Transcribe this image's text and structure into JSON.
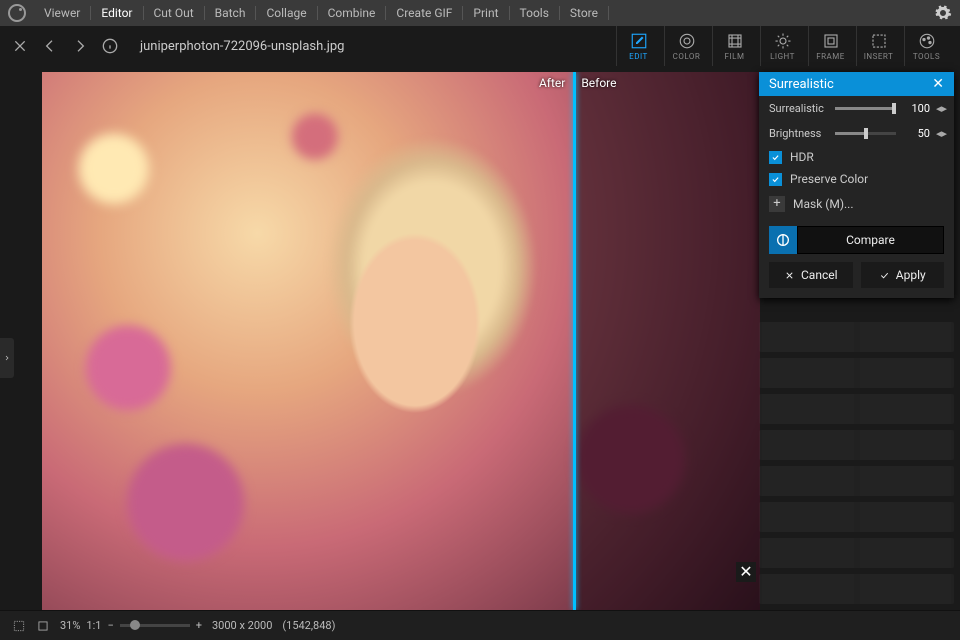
{
  "topmenu": {
    "items": [
      "Viewer",
      "Editor",
      "Cut Out",
      "Batch",
      "Collage",
      "Combine",
      "Create GIF",
      "Print",
      "Tools",
      "Store"
    ],
    "active_index": 1
  },
  "subbar": {
    "filename": "juniperphoton-722096-unsplash.jpg",
    "tools": [
      {
        "label": "EDIT",
        "icon": "edit-box",
        "active": true
      },
      {
        "label": "COLOR",
        "icon": "circle"
      },
      {
        "label": "FILM",
        "icon": "film"
      },
      {
        "label": "LIGHT",
        "icon": "sun"
      },
      {
        "label": "FRAME",
        "icon": "frame"
      },
      {
        "label": "INSERT",
        "icon": "select"
      },
      {
        "label": "TOOLS",
        "icon": "palette"
      }
    ]
  },
  "compare": {
    "after_label": "After",
    "before_label": "Before"
  },
  "panel": {
    "title": "Surrealistic",
    "sliders": [
      {
        "label": "Surrealistic",
        "value": 100,
        "pct": 100
      },
      {
        "label": "Brightness",
        "value": 50,
        "pct": 50
      }
    ],
    "checks": [
      {
        "label": "HDR",
        "checked": true
      },
      {
        "label": "Preserve Color",
        "checked": true
      }
    ],
    "mask_label": "Mask (M)...",
    "compare_label": "Compare",
    "cancel_label": "Cancel",
    "apply_label": "Apply"
  },
  "bottom": {
    "zoom_pct": "31%",
    "ratio": "1:1",
    "dimensions": "3000 x 2000",
    "cursor": "(1542,848)"
  },
  "colors": {
    "accent": "#0a90d8",
    "divider": "#00c0ff"
  }
}
